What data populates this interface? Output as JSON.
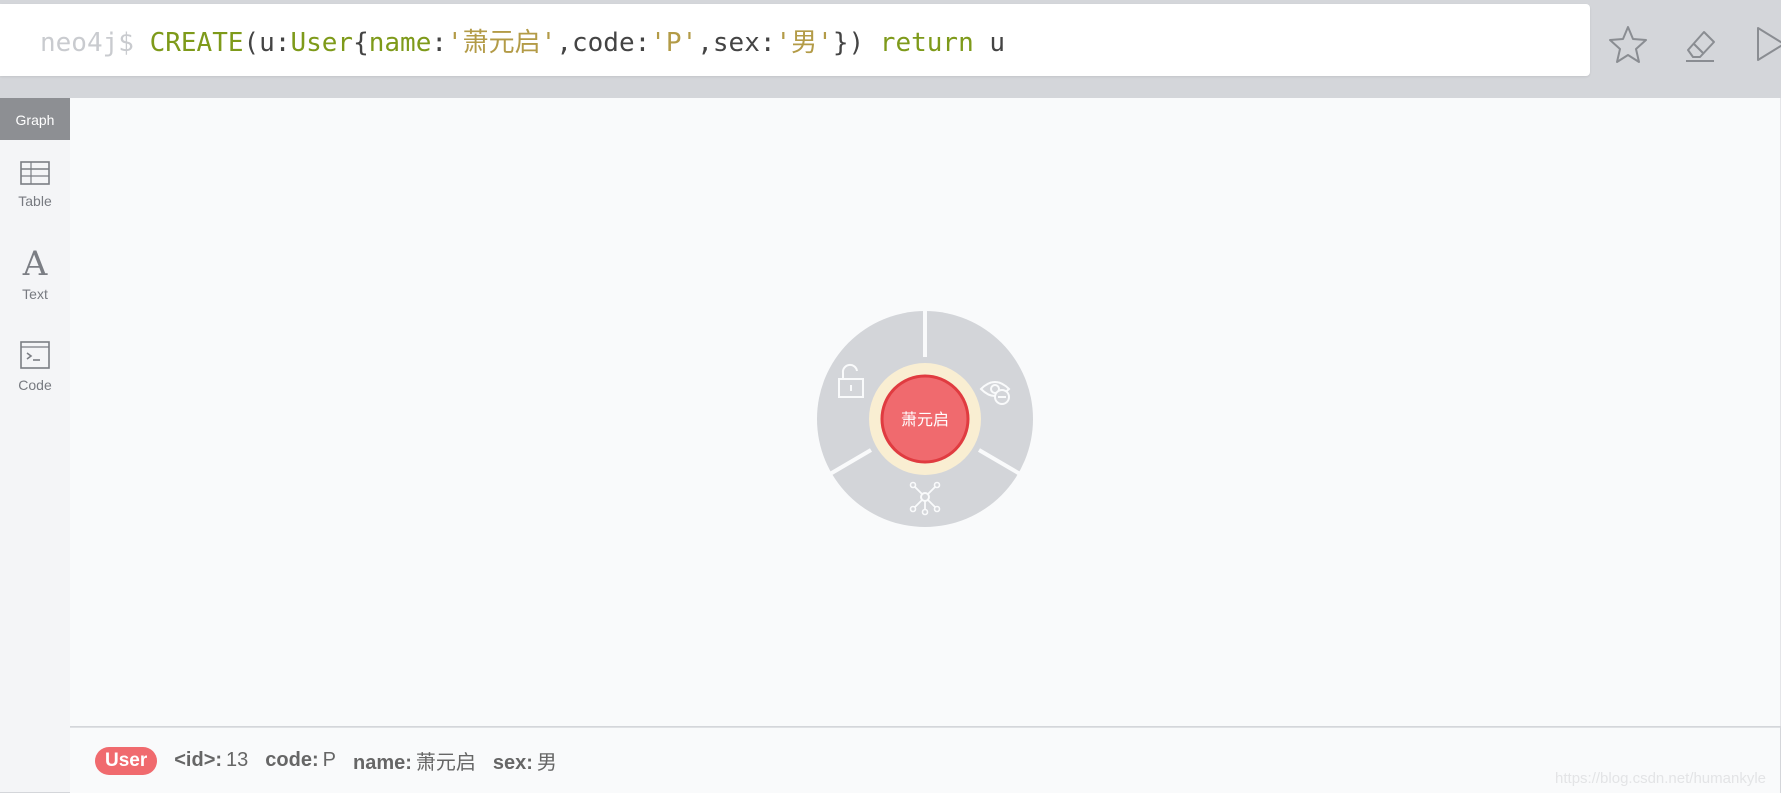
{
  "editor": {
    "prompt": "neo4j$ ",
    "tokens": [
      {
        "text": "CREATE",
        "type": "kw"
      },
      {
        "text": "(u:",
        "type": "plain"
      },
      {
        "text": "User",
        "type": "label"
      },
      {
        "text": "{",
        "type": "plain"
      },
      {
        "text": "name",
        "type": "prop"
      },
      {
        "text": ":",
        "type": "plain"
      },
      {
        "text": "'萧元启'",
        "type": "str"
      },
      {
        "text": ",code:",
        "type": "plain"
      },
      {
        "text": "'P'",
        "type": "str"
      },
      {
        "text": ",sex:",
        "type": "plain"
      },
      {
        "text": "'男'",
        "type": "str"
      },
      {
        "text": "}) ",
        "type": "plain"
      },
      {
        "text": "return",
        "type": "kw"
      },
      {
        "text": " u",
        "type": "plain"
      }
    ],
    "actions": [
      "star-icon",
      "eraser-icon",
      "play-icon"
    ]
  },
  "sidebar": {
    "items": [
      {
        "label": "Graph",
        "icon": "graph-icon",
        "active": true
      },
      {
        "label": "Table",
        "icon": "table-icon"
      },
      {
        "label": "Text",
        "icon": "text-icon"
      },
      {
        "label": "Code",
        "icon": "code-icon"
      }
    ]
  },
  "graph": {
    "node": {
      "caption": "萧元启",
      "color": "#f06a6e",
      "border": "#e03b40"
    },
    "ring_actions": [
      "unlock-icon",
      "hide-icon",
      "expand-icon"
    ]
  },
  "status": {
    "label": "User",
    "properties": [
      {
        "key": "<id>:",
        "value": "13"
      },
      {
        "key": "code:",
        "value": "P"
      },
      {
        "key": "name:",
        "value": "萧元启"
      },
      {
        "key": "sex:",
        "value": "男"
      }
    ]
  },
  "watermark": "https://blog.csdn.net/humankyle"
}
